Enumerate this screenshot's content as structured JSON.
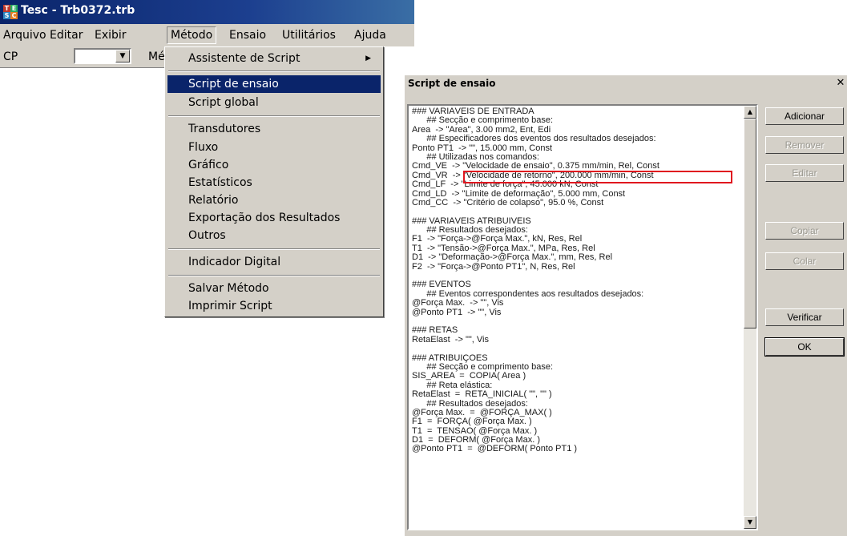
{
  "app": {
    "title": "Tesc - Trb0372.trb",
    "icon_letters": [
      "T",
      "E",
      "S",
      "C"
    ]
  },
  "menubar": {
    "items": [
      "Arquivo",
      "Editar",
      "Exibir",
      "Método",
      "Ensaio",
      "Utilitários",
      "Ajuda"
    ]
  },
  "toolbar": {
    "cp_label": "CP",
    "combo_value": "",
    "me_label": "Mé"
  },
  "dropdown": {
    "items": [
      "Assistente de Script",
      "Script de ensaio",
      "Script global",
      "Transdutores",
      "Fluxo",
      "Gráfico",
      "Estatísticos",
      "Relatório",
      "Exportação dos Resultados",
      "Outros",
      "Indicador Digital",
      "Salvar Método",
      "Imprimir Script"
    ],
    "submenu_arrow": "▶"
  },
  "dialog": {
    "title": "Script de ensaio",
    "close_glyph": "✕",
    "buttons": {
      "adicionar": "Adicionar",
      "remover": "Remover",
      "editar": "Editar",
      "copiar": "Copiar",
      "colar": "Colar",
      "verificar": "Verificar",
      "ok": "OK"
    },
    "script_lines": [
      "### VARIÁVEIS DE ENTRADA",
      "      ## Secção e comprimento base:",
      "Area  -> \"Área\", 3.00 mm2, Ent, Edi",
      "      ## Especificadores dos eventos dos resultados desejados:",
      "Ponto PT1  -> \"\", 15.000 mm, Const",
      "      ## Utilizadas nos comandos:",
      "Cmd_VE  -> \"Velocidade de ensaio\", 0.375 mm/min, Rel, Const",
      "Cmd_VR  -> \"Velocidade de retorno\", 200.000 mm/min, Const",
      "Cmd_LF  -> \"Limite de força\", 45.000 kN, Const",
      "Cmd_LD  -> \"Limite de deformação\", 5.000 mm, Const",
      "Cmd_CC  -> \"Critério de colapso\", 95.0 %, Const",
      "",
      "### VARIÁVEIS ATRIBUÍVEIS",
      "      ## Resultados desejados:",
      "F1  -> \"Força->@Força Max.\", kN, Res, Rel",
      "T1  -> \"Tensão->@Força Max.\", MPa, Res, Rel",
      "D1  -> \"Deformação->@Força Max.\", mm, Res, Rel",
      "F2  -> \"Força->@Ponto PT1\", N, Res, Rel",
      "",
      "### EVENTOS",
      "      ## Eventos correspondentes aos resultados desejados:",
      "@Força Max.  -> \"\", Vis",
      "@Ponto PT1  -> \"\", Vis",
      "",
      "### RETAS",
      "RetaElast  -> \"\", Vis",
      "",
      "### ATRIBUIÇÕES",
      "      ## Secção e comprimento base:",
      "SIS_ÁREA  =  CÓPIA( Area )",
      "      ## Reta elástica:",
      "RetaElast  =  RETA_INICIAL( \"\", \"\" )",
      "      ## Resultados desejados:",
      "@Força Max.  =  @FORÇA_MAX( )",
      "F1  =  FORÇA( @Força Max. )",
      "T1  =  TENSÃO( @Força Max. )",
      "D1  =  DEFORM( @Força Max. )",
      "@Ponto PT1  =  @DEFORM( Ponto PT1 )"
    ],
    "highlight_color": "#e0161f"
  }
}
